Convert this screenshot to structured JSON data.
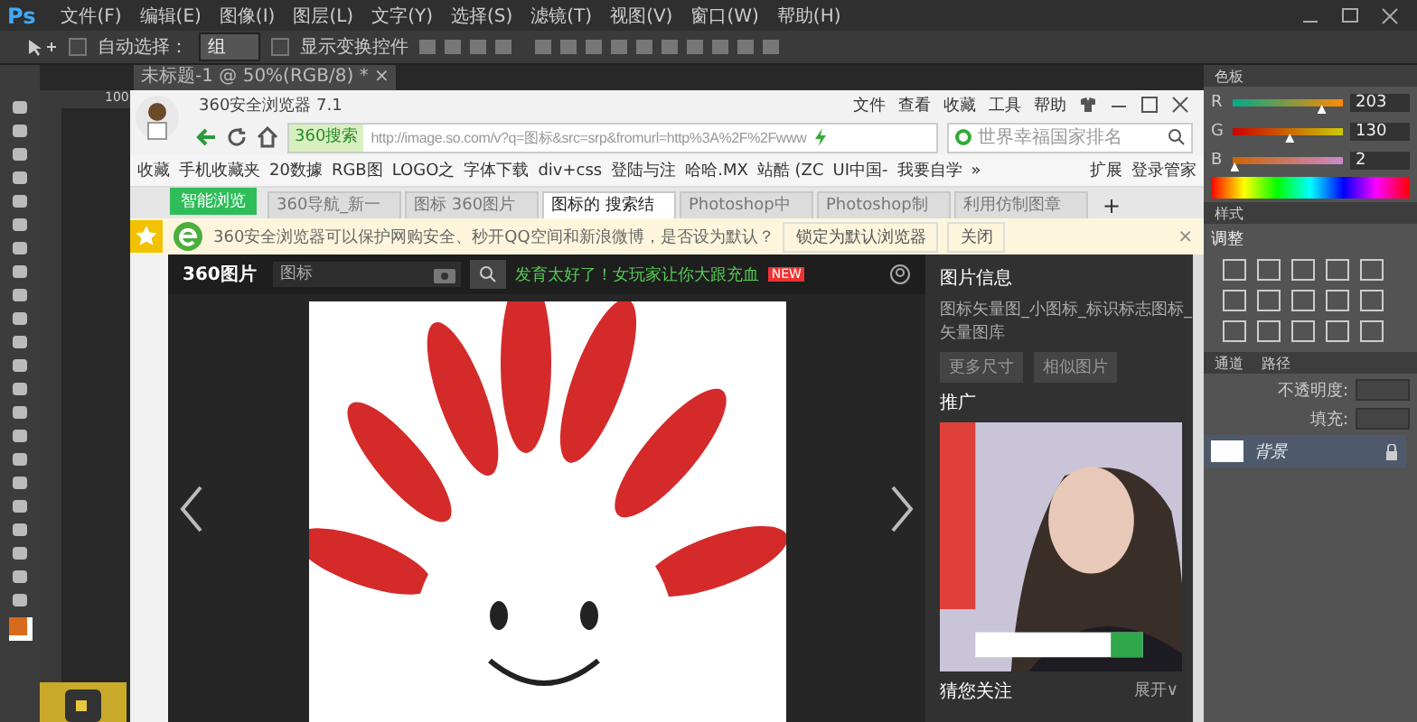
{
  "ps": {
    "logo": "Ps",
    "menu": [
      "文件(F)",
      "编辑(E)",
      "图像(I)",
      "图层(L)",
      "文字(Y)",
      "选择(S)",
      "滤镜(T)",
      "视图(V)",
      "窗口(W)",
      "帮助(H)"
    ],
    "options": {
      "auto_select": {
        "label": "自动选择：",
        "checked": false
      },
      "auto_select_value": "组",
      "transform": {
        "label": "显示变换控件",
        "checked": false
      }
    },
    "doc_tab": {
      "title": "未标题-1 @ 50%(RGB/8) *",
      "close": "×"
    },
    "ruler": "100",
    "color_panel": {
      "title": "色板",
      "channels": [
        {
          "name": "R",
          "level": 0.8,
          "value": "203"
        },
        {
          "name": "G",
          "level": 0.51,
          "value": "130"
        },
        {
          "name": "B",
          "level": 0.01,
          "value": "2"
        }
      ]
    },
    "styles_panel": {
      "title": "样式"
    },
    "adjust_panel": {
      "title": "调整"
    },
    "layers_panel": {
      "tabs": [
        {
          "label": "通道",
          "selected": false
        },
        {
          "label": "路径",
          "selected": false
        }
      ],
      "opacity_label": "不透明度:",
      "fill_label": "填充:",
      "layer": "背景"
    }
  },
  "browser": {
    "title": "360安全浏览器 7.1",
    "menu": [
      "文件",
      "查看",
      "收藏",
      "工具",
      "帮助"
    ],
    "search_engine": "360搜索",
    "url": "http://image.so.com/v?q=图标&src=srp&fromurl=http%3A%2F%2Fwww",
    "search_placeholder": "世界幸福国家排名",
    "bookmarks": [
      "收藏",
      "手机收藏夹",
      "20数據",
      "RGB图",
      "LOGO之",
      "字体下载",
      "div+css",
      "登陆与注",
      "哈哈.MX",
      "站酷 (ZC",
      "UI中国-",
      "我要自学",
      "»"
    ],
    "ext": "扩展",
    "login": "登录管家",
    "smart": "智能浏览",
    "tabs": [
      {
        "label": "360导航_新一",
        "selected": false
      },
      {
        "label": "图标 360图片",
        "selected": false
      },
      {
        "label": "图标的 搜索结",
        "selected": true
      },
      {
        "label": "Photoshop中",
        "selected": false
      },
      {
        "label": "Photoshop制",
        "selected": false
      },
      {
        "label": "利用仿制图章",
        "selected": false
      }
    ],
    "new_tab": "+",
    "notice": {
      "text": "360安全浏览器可以保护网购安全、秒开QQ空间和新浪微博，是否设为默认？",
      "set_default": "锁定为默认浏览器",
      "close": "关闭",
      "dismiss": "×"
    },
    "viewer": {
      "logo": "360图片",
      "query": "图标",
      "promo": "发育太好了！女玩家让你大跟充血",
      "promo_badge": "NEW",
      "info_title": "图片信息",
      "info_text": "图标矢量图_小图标_标识标志图标_矢量图库",
      "more_sizes": "更多尺寸",
      "similar": "相似图片",
      "ad_title": "推广",
      "follow_title": "猜您关注",
      "expand": "展开∨"
    }
  }
}
